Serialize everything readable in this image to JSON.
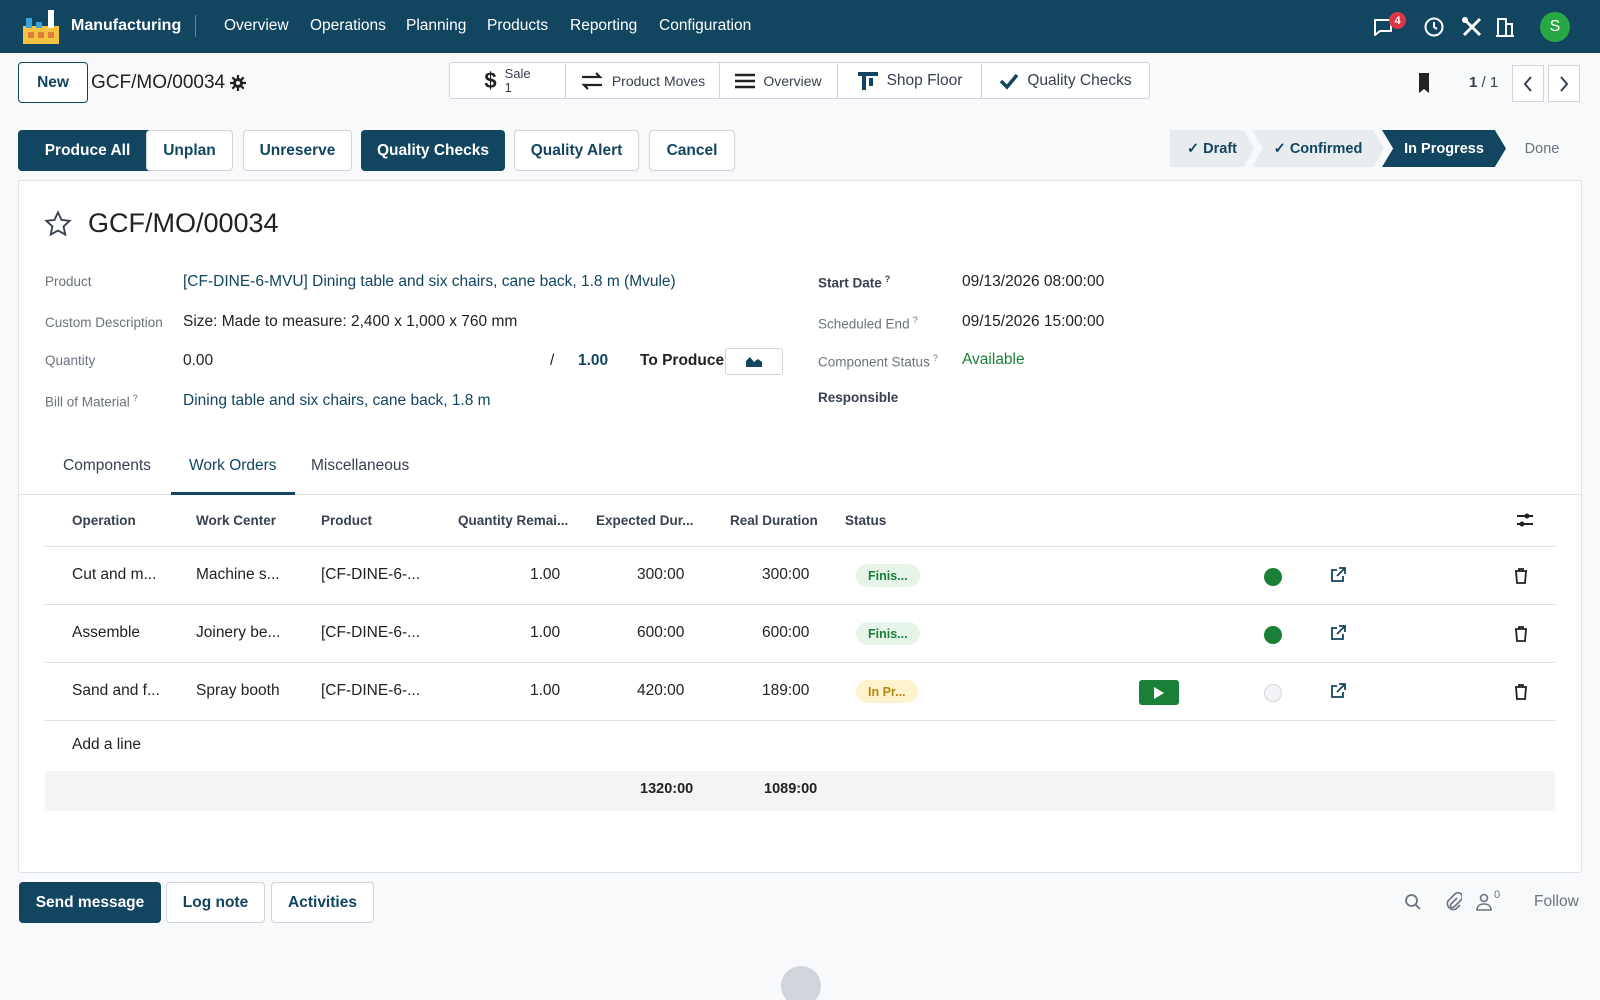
{
  "topnav": {
    "app_name": "Manufacturing",
    "menu": [
      "Overview",
      "Operations",
      "Planning",
      "Products",
      "Reporting",
      "Configuration"
    ],
    "message_count": "4",
    "user_initial": "S"
  },
  "control": {
    "new_label": "New",
    "record_name": "GCF/MO/00034",
    "smart_buttons": {
      "sale_label": "Sale",
      "sale_count": "1",
      "product_moves": "Product Moves",
      "overview": "Overview",
      "shop_floor": "Shop Floor",
      "quality_checks": "Quality Checks"
    },
    "pager": {
      "current": "1",
      "total": "1"
    }
  },
  "actions": {
    "produce_all": "Produce All",
    "unplan": "Unplan",
    "unreserve": "Unreserve",
    "quality_checks": "Quality Checks",
    "quality_alert": "Quality Alert",
    "cancel": "Cancel"
  },
  "statusbar": {
    "draft": "✓ Draft",
    "confirmed": "✓ Confirmed",
    "in_progress": "In Progress",
    "done": "Done"
  },
  "form": {
    "title": "GCF/MO/00034",
    "product_label": "Product",
    "product_value": "[CF-DINE-6-MVU] Dining table and six chairs, cane back, 1.8 m (Mvule)",
    "custom_desc_label": "Custom Description",
    "custom_desc_value": "Size: Made to measure: 2,400 x 1,000 x 760 mm",
    "quantity_label": "Quantity",
    "quantity_value": "0.00",
    "quantity_sep": "/",
    "quantity_target": "1.00",
    "to_produce": "To Produce",
    "bom_label": "Bill of Material",
    "bom_value": "Dining table and six chairs, cane back, 1.8 m",
    "start_date_label": "Start Date",
    "start_date_value": "09/13/2026 08:00:00",
    "scheduled_end_label": "Scheduled End",
    "scheduled_end_value": "09/15/2026 15:00:00",
    "component_status_label": "Component Status",
    "component_status_value": "Available",
    "responsible_label": "Responsible",
    "help_mark": "?"
  },
  "tabs": [
    "Components",
    "Work Orders",
    "Miscellaneous"
  ],
  "workorders": {
    "headers": [
      "Operation",
      "Work Center",
      "Product",
      "Quantity Remai...",
      "Expected Dur...",
      "Real Duration",
      "Status"
    ],
    "rows": [
      {
        "operation": "Cut and m...",
        "center": "Machine s...",
        "product": "[CF-DINE-6-...",
        "qty": "1.00",
        "expected": "300:00",
        "real": "300:00",
        "status": "Finis..."
      },
      {
        "operation": "Assemble",
        "center": "Joinery be...",
        "product": "[CF-DINE-6-...",
        "qty": "1.00",
        "expected": "600:00",
        "real": "600:00",
        "status": "Finis..."
      },
      {
        "operation": "Sand and f...",
        "center": "Spray booth",
        "product": "[CF-DINE-6-...",
        "qty": "1.00",
        "expected": "420:00",
        "real": "189:00",
        "status": "In Pr..."
      }
    ],
    "add_line": "Add a line",
    "total_expected": "1320:00",
    "total_real": "1089:00"
  },
  "chatter": {
    "send_message": "Send message",
    "log_note": "Log note",
    "activities": "Activities",
    "follower_count": "0",
    "follow": "Follow"
  },
  "colors": {
    "primary": "#124560",
    "success": "#1a7f37",
    "warning": "#b8860b"
  }
}
